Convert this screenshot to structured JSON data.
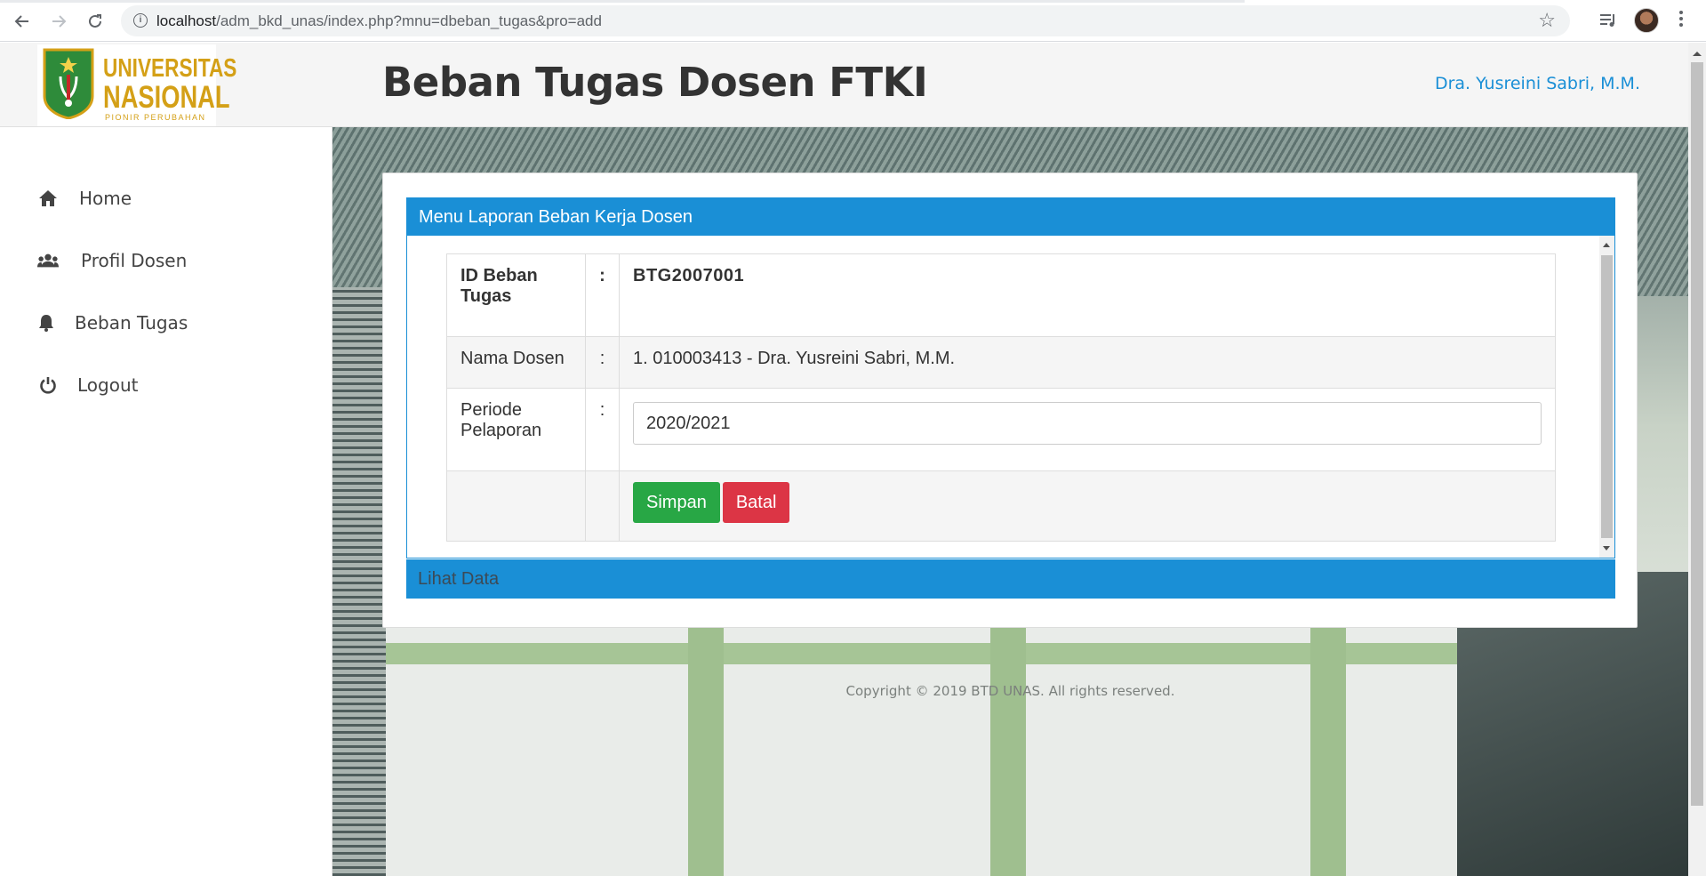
{
  "browser": {
    "url_host": "localhost",
    "url_path": "/adm_bkd_unas/index.php?mnu=dbeban_tugas&pro=add",
    "icons": [
      "back-arrow-icon",
      "forward-arrow-icon",
      "reload-icon",
      "info-icon",
      "bookmark-star-icon",
      "media-queue-icon",
      "profile-avatar",
      "menu-kebab-icon"
    ]
  },
  "logo": {
    "line1": "UNIVERSITAS",
    "line2": "NASIONAL",
    "line3": "PIONIR PERUBAHAN"
  },
  "sidebar": {
    "items": [
      {
        "label": "Home",
        "icon": "home-icon"
      },
      {
        "label": "Profil Dosen",
        "icon": "users-icon"
      },
      {
        "label": "Beban Tugas",
        "icon": "bell-icon"
      },
      {
        "label": "Logout",
        "icon": "power-icon"
      }
    ]
  },
  "header": {
    "title": "Beban Tugas Dosen FTKI",
    "user": "Dra. Yusreini Sabri, M.M."
  },
  "panel": {
    "title": "Menu Laporan Beban Kerja Dosen",
    "rows": {
      "id_label": "ID Beban Tugas",
      "id_value": "BTG2007001",
      "nama_label": "Nama Dosen",
      "nama_value": "1. 010003413 - Dra. Yusreini Sabri, M.M.",
      "periode_label": "Periode Pelaporan",
      "periode_value": "2020/2021",
      "colon": ":"
    },
    "buttons": {
      "save": "Simpan",
      "cancel": "Batal"
    }
  },
  "panel2": {
    "title": "Lihat Data"
  },
  "footer": {
    "copyright": "Copyright © 2019 BTD UNAS. All rights reserved."
  },
  "colors": {
    "accent": "#1a8fd6",
    "save": "#28a745",
    "cancel": "#dc3545",
    "logo_gold": "#d4a017",
    "logo_green": "#2e8b3a"
  }
}
